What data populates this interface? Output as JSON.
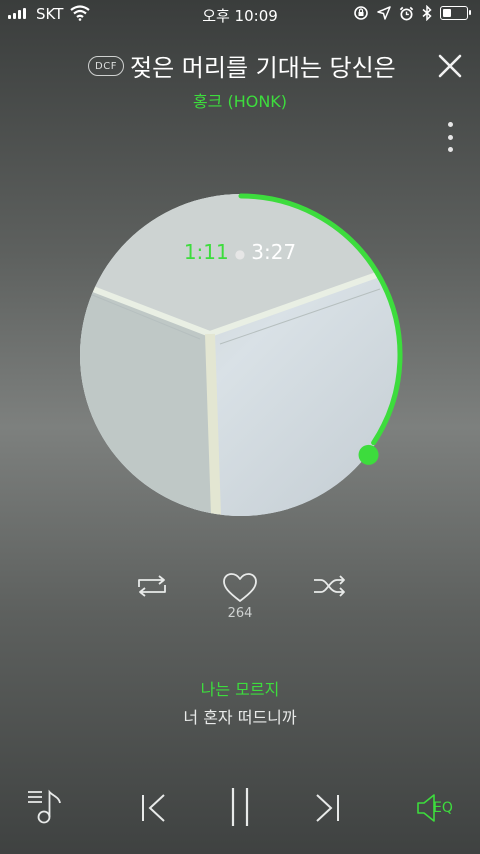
{
  "status_bar": {
    "carrier": "SKT",
    "time": "오후 10:09",
    "battery_level": 0.35
  },
  "song": {
    "badge": "DCF",
    "title": "젖은 머리를 기대는 당신은",
    "artist": "홍크 (HONK)"
  },
  "playback": {
    "current_time": "1:11",
    "total_time": "3:27",
    "progress_fraction": 0.343
  },
  "likes": "264",
  "lyrics": {
    "current_line": "나는 모르지",
    "next_line": "너 혼자 떠드니까"
  },
  "bottom_bar": {
    "eq_label": "EQ"
  },
  "colors": {
    "accent": "#3ddc3d",
    "icon": "#e8eae9"
  },
  "icons": [
    "signal-icon",
    "wifi-icon",
    "screen-lock-icon",
    "location-icon",
    "alarm-icon",
    "bluetooth-icon",
    "battery-icon",
    "close-icon",
    "more-vertical-icon",
    "repeat-icon",
    "heart-icon",
    "shuffle-icon",
    "playlist-icon",
    "previous-icon",
    "pause-icon",
    "next-icon",
    "eq-icon"
  ]
}
